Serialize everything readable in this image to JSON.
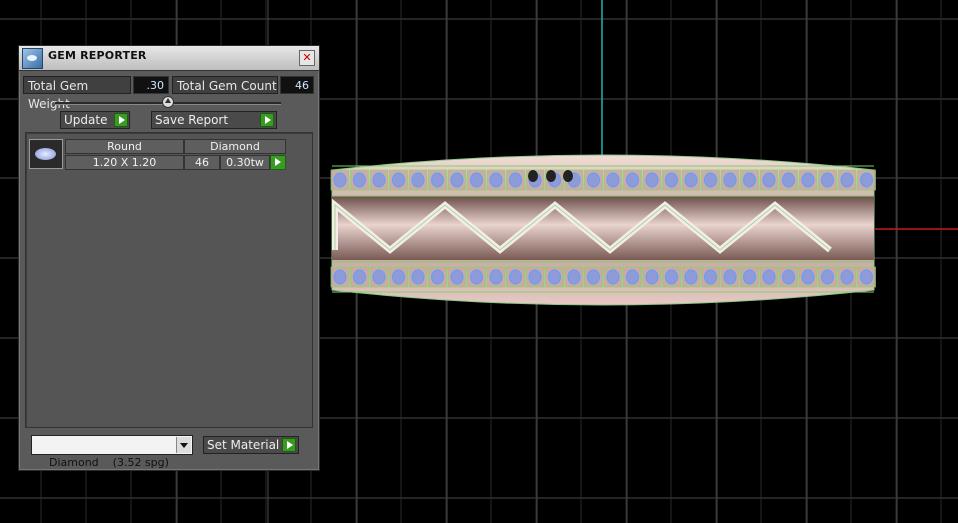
{
  "window": {
    "title": "GEM REPORTER",
    "close_icon": "close-icon",
    "app_icon": "gem-reporter-icon"
  },
  "totals": {
    "weight_label": "Total Gem Weight",
    "weight_value": ".30",
    "count_label": "Total Gem Count",
    "count_value": "46"
  },
  "toolbar": {
    "update_label": "Update",
    "save_label": "Save Report"
  },
  "gem_list": {
    "headers": {
      "shape": "Round",
      "material": "Diamond"
    },
    "rows": [
      {
        "size": "1.20 X 1.20",
        "count": "46",
        "weight": "0.30tw",
        "thumb_icon": "round-gem-icon"
      }
    ]
  },
  "material": {
    "selected": "Diamond    (3.52 spg)",
    "set_label": "Set Material"
  },
  "colors": {
    "grid": "#4a4a4a",
    "axis_vertical": "#1fb5b5",
    "axis_horizontal": "#c41a1a",
    "ring_metal": "#d9b8b0",
    "gem_wire": "#5aa0ff",
    "prong_wire": "#7fd46a",
    "accent_play": "#3a9b24"
  }
}
